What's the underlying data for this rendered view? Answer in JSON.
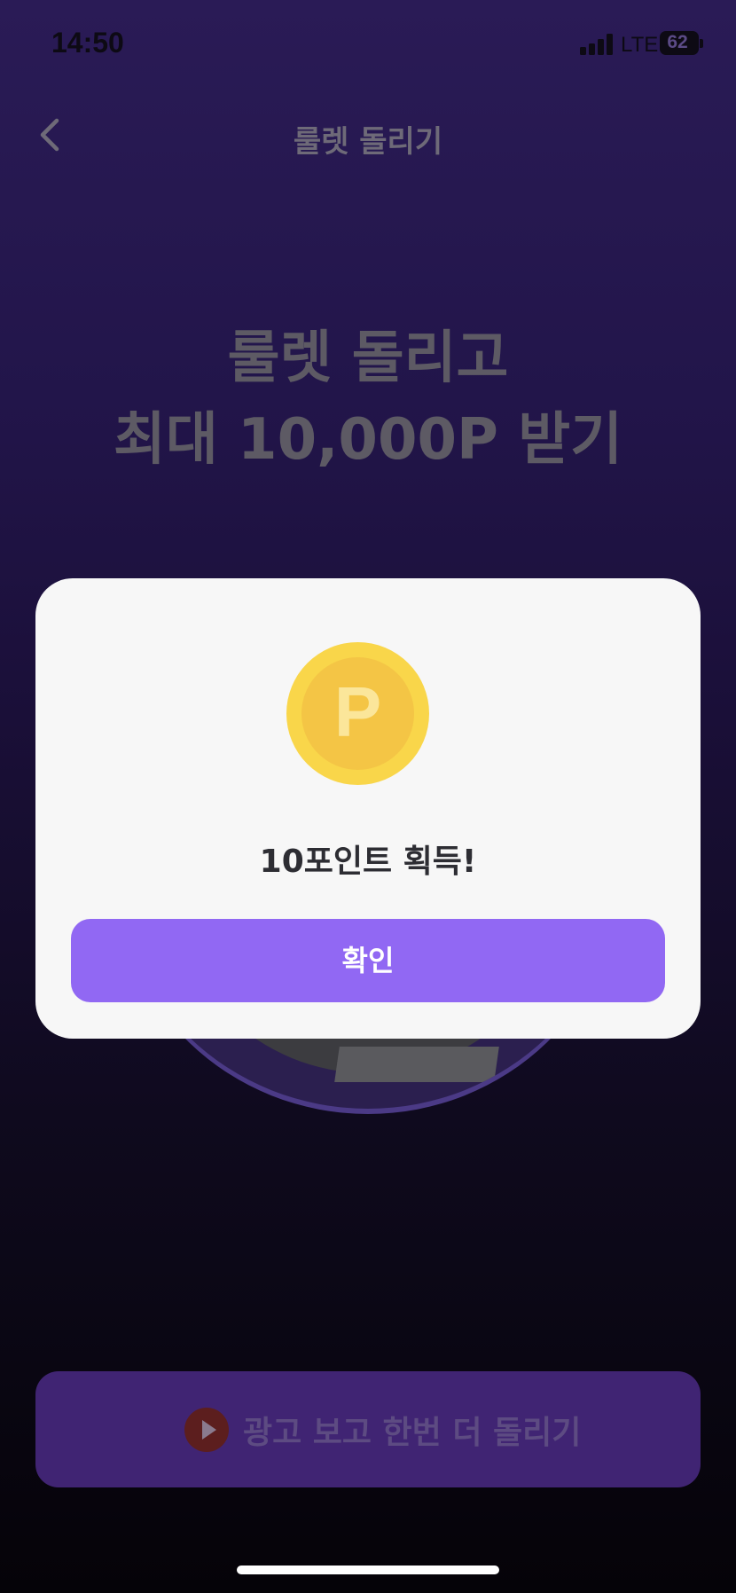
{
  "status_bar": {
    "time": "14:50",
    "network": "LTE",
    "battery": "62"
  },
  "nav": {
    "title": "룰렛 돌리기",
    "back_icon": "chevron-left-icon"
  },
  "headline": {
    "line1": "룰렛 돌리고",
    "line2": "최대 10,000P 받기"
  },
  "modal": {
    "coin_letter": "P",
    "message": "10포인트 획득!",
    "confirm_label": "확인"
  },
  "bottom": {
    "ad_button_label": "광고 보고 한번 더 돌리기",
    "play_icon": "play-icon"
  },
  "colors": {
    "accent": "#9168f3",
    "coin": "#f9d64a",
    "bottom_button": "#402473",
    "modal_background": "#f7f7f7"
  }
}
